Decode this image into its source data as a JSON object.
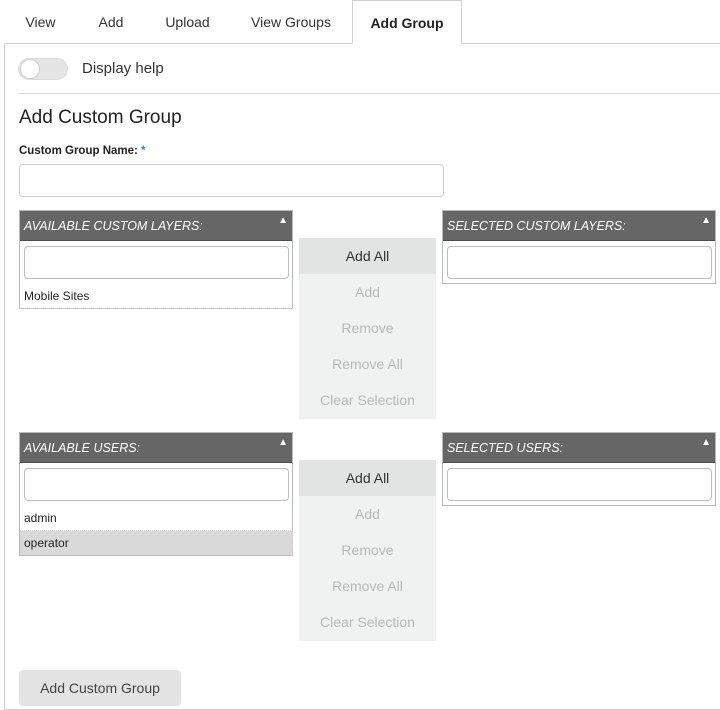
{
  "tabs": [
    {
      "label": "View"
    },
    {
      "label": "Add"
    },
    {
      "label": "Upload"
    },
    {
      "label": "View Groups"
    },
    {
      "label": "Add Group",
      "active": true
    }
  ],
  "help": {
    "label": "Display help",
    "enabled": false
  },
  "form": {
    "title": "Add Custom Group",
    "name_label": "Custom Group Name:",
    "required_mark": "*",
    "name_value": ""
  },
  "layers": {
    "available_header": "AVAILABLE CUSTOM LAYERS:",
    "selected_header": "SELECTED CUSTOM LAYERS:",
    "available_filter": "",
    "selected_filter": "",
    "available_items": [
      "Mobile Sites"
    ],
    "selected_items": []
  },
  "users": {
    "available_header": "AVAILABLE USERS:",
    "selected_header": "SELECTED USERS:",
    "available_filter": "",
    "selected_filter": "",
    "available_items": [
      "admin",
      "operator"
    ],
    "highlighted_item": "operator",
    "selected_items": []
  },
  "actions": {
    "add_all": "Add All",
    "add": "Add",
    "remove": "Remove",
    "remove_all": "Remove All",
    "clear_selection": "Clear Selection"
  },
  "submit_label": "Add Custom Group",
  "icons": {
    "sort": "triangle-up-icon"
  },
  "colors": {
    "header_bg": "#666666",
    "required": "#2a7fc7"
  }
}
